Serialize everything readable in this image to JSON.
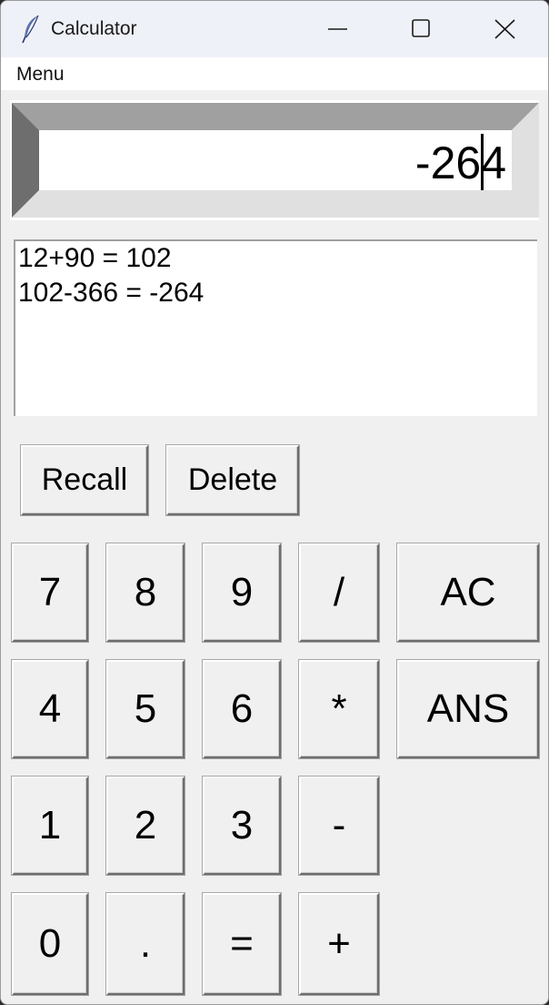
{
  "window": {
    "title": "Calculator",
    "icon": "feather-icon"
  },
  "menubar": {
    "menu_label": "Menu"
  },
  "display": {
    "value": "-264"
  },
  "history": {
    "lines": [
      "12+90 = 102",
      "102-366 = -264"
    ]
  },
  "actions": {
    "recall_label": "Recall",
    "delete_label": "Delete"
  },
  "keypad": {
    "k7": "7",
    "k8": "8",
    "k9": "9",
    "div": "/",
    "ac": "AC",
    "k4": "4",
    "k5": "5",
    "k6": "6",
    "mul": "*",
    "ans": "ANS",
    "k1": "1",
    "k2": "2",
    "k3": "3",
    "sub": "-",
    "k0": "0",
    "dot": ".",
    "eq": "=",
    "add": "+"
  }
}
